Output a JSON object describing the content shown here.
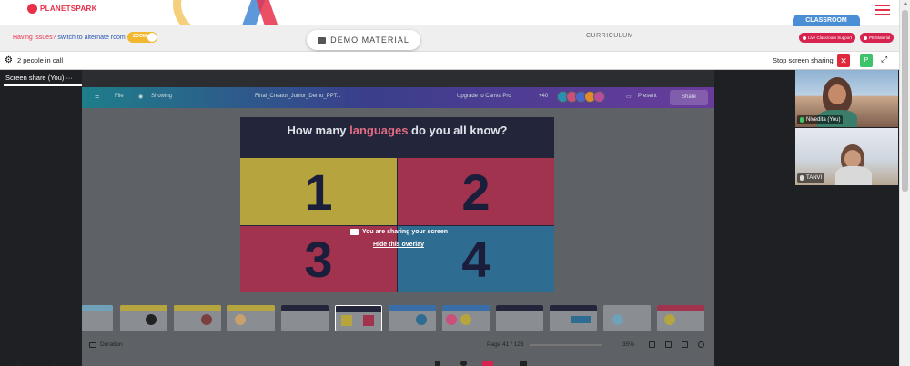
{
  "brand": {
    "logo_text": "PLANETSPARK"
  },
  "subbar": {
    "issue_question": "Having issues?",
    "issue_link": "switch to alternate room",
    "toggle_label": "ZOOM",
    "demo_button": "DEMO MATERIAL",
    "curriculum": "CURRICULUM",
    "classroom_tag": "CLASSROOM",
    "live_support": "Live Classroom Support",
    "pe_material": "PE Material"
  },
  "callbar": {
    "people_count": "2 people in call",
    "stop_sharing": "Stop screen sharing",
    "p_label": "P"
  },
  "share": {
    "label": "Screen share (You)",
    "menu": "···"
  },
  "canva": {
    "file": "File",
    "mode": "Showing",
    "doc_title": "Final_Creator_Junior_Demo_PPT...",
    "upgrade": "Upgrade to Canva Pro",
    "count": "+40",
    "present": "Present",
    "share": "Share",
    "avatars": [
      "#2a8fb0",
      "#c9507a",
      "#4a67c9",
      "#e08a2c",
      "#b84e9a"
    ]
  },
  "slide": {
    "title_pre": "How many ",
    "title_highlight": "languages",
    "title_post": " do you all know?",
    "q1": "1",
    "q2": "2",
    "q3": "3",
    "q4": "4"
  },
  "overlay": {
    "message": "You are sharing your screen",
    "hide": "Hide this overlay"
  },
  "bottom": {
    "duration": "Duration",
    "page": "Page 41 / 123",
    "zoom": "35%"
  },
  "participants": [
    {
      "name": "Nivedita (You)"
    },
    {
      "name": "TANVI"
    }
  ]
}
